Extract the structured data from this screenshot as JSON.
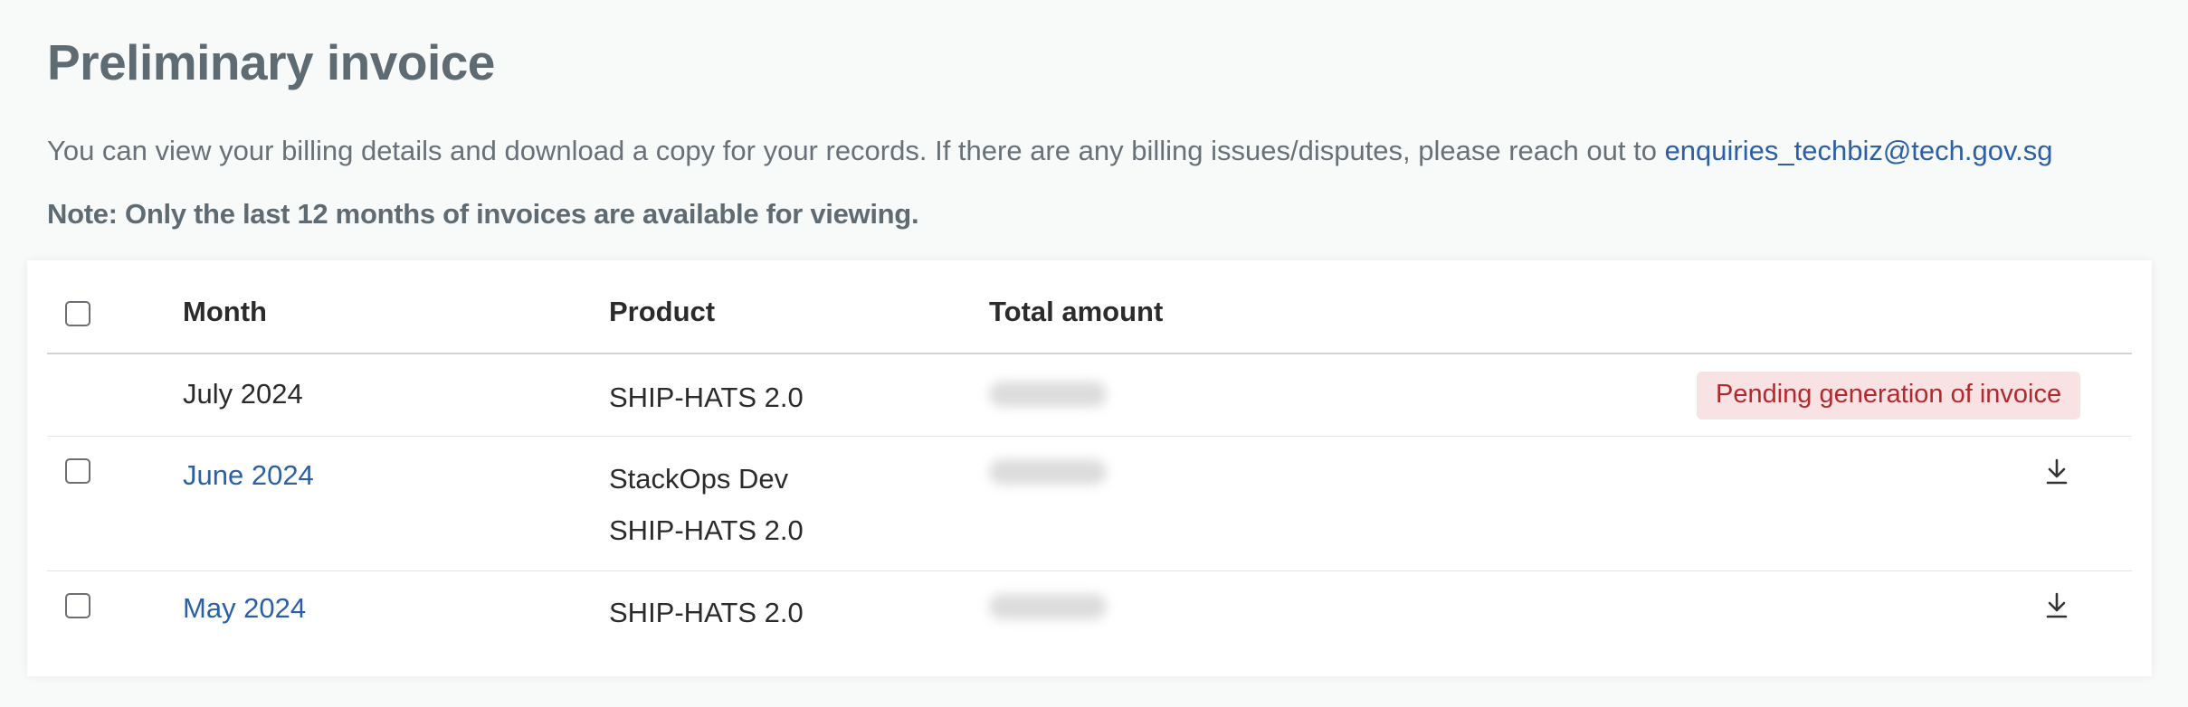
{
  "page": {
    "title": "Preliminary invoice",
    "intro_text": "You can view your billing details and download a copy for your records. If there are any billing issues/disputes, please reach out to ",
    "intro_email": "enquiries_techbiz@tech.gov.sg",
    "note": "Note: Only the last 12 months of invoices are available for viewing."
  },
  "table": {
    "headers": {
      "month": "Month",
      "product": "Product",
      "total_amount": "Total amount"
    },
    "rows": [
      {
        "month": "July 2024",
        "products": [
          "SHIP-HATS 2.0"
        ],
        "status": "Pending generation of invoice"
      },
      {
        "month": "June 2024",
        "products": [
          "StackOps Dev",
          "SHIP-HATS 2.0"
        ]
      },
      {
        "month": "May 2024",
        "products": [
          "SHIP-HATS 2.0"
        ]
      }
    ]
  },
  "colors": {
    "link": "#2b5fa6",
    "badge_background": "#f8e2e3",
    "badge_text": "#b3282d",
    "title": "#5f6b73"
  },
  "icons": {
    "download": "download-icon",
    "checkbox": "checkbox"
  }
}
